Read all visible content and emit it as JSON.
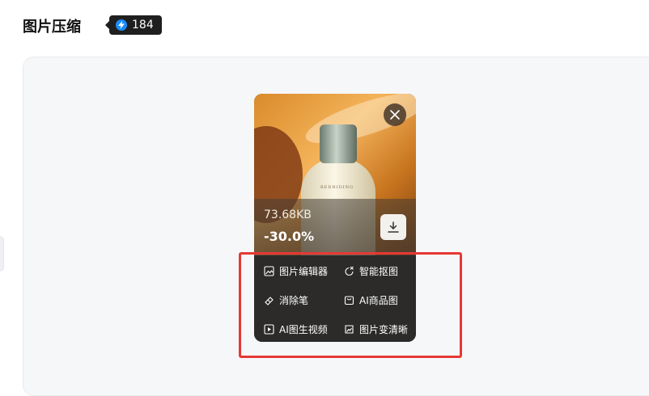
{
  "header": {
    "title": "图片压缩",
    "credits": "184"
  },
  "card": {
    "file_size": "73.68KB",
    "compression_ratio": "-30.0%",
    "product_label": "REDNIDING"
  },
  "menu": {
    "image_editor": "图片编辑器",
    "smart_cutout": "智能抠图",
    "eraser": "消除笔",
    "ai_product_image": "AI商品图",
    "ai_image_to_video": "AI图生视频",
    "image_sharpen": "图片变清晰"
  },
  "colors": {
    "highlight": "#e53935",
    "badge_bg": "#1f1f1f",
    "menu_bg": "#2c2b2a"
  }
}
